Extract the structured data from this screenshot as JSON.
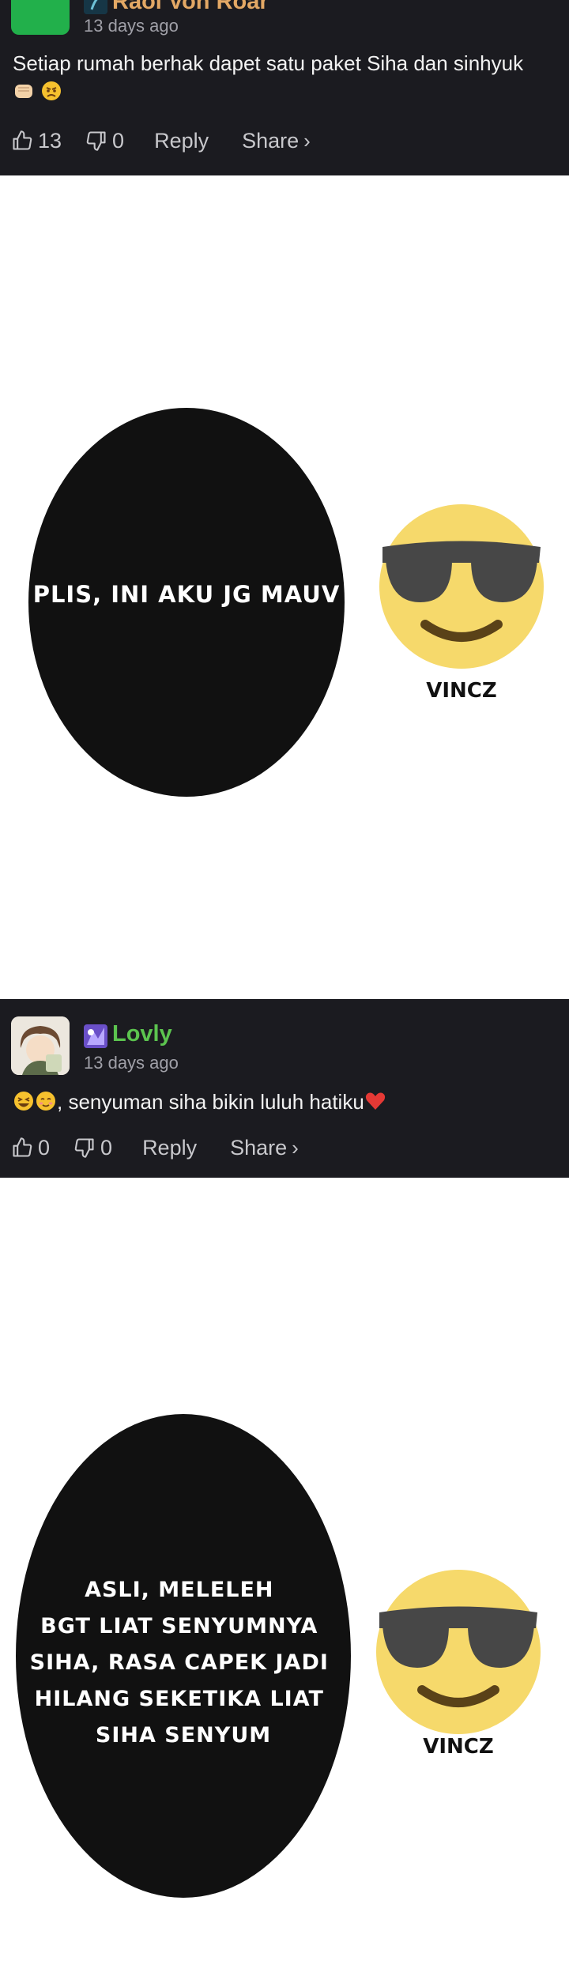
{
  "comment1": {
    "username": "Raol Von Roar",
    "timestamp": "13 days ago",
    "text": "Setiap rumah berhak dapet satu paket Siha dan sinhyuk",
    "likes": "13",
    "dislikes": "0",
    "reply_label": "Reply",
    "share_label": "Share",
    "avatar_color": "#22b04b",
    "username_color": "#e3a865"
  },
  "meme1": {
    "bubble_text": "PLIS, INI AKU JG MAUV",
    "label": "VINCZ"
  },
  "comment2": {
    "username": "Lovly",
    "timestamp": "13 days ago",
    "text": ", senyuman siha bikin luluh hatiku",
    "likes": "0",
    "dislikes": "0",
    "reply_label": "Reply",
    "share_label": "Share",
    "username_color": "#5cc44f"
  },
  "meme2": {
    "bubble_lines": [
      "ASLI, MELELEH",
      "BGT LIAT SENYUMNYA",
      "SIHA, RASA CAPEK JADI",
      "HILANG SEKETIKA LIAT",
      "SIHA SENYUM"
    ],
    "label": "VINCZ"
  },
  "icons": {
    "like": "thumbs-up-icon",
    "dislike": "thumbs-down-icon",
    "share": "chevron-right-icon"
  }
}
